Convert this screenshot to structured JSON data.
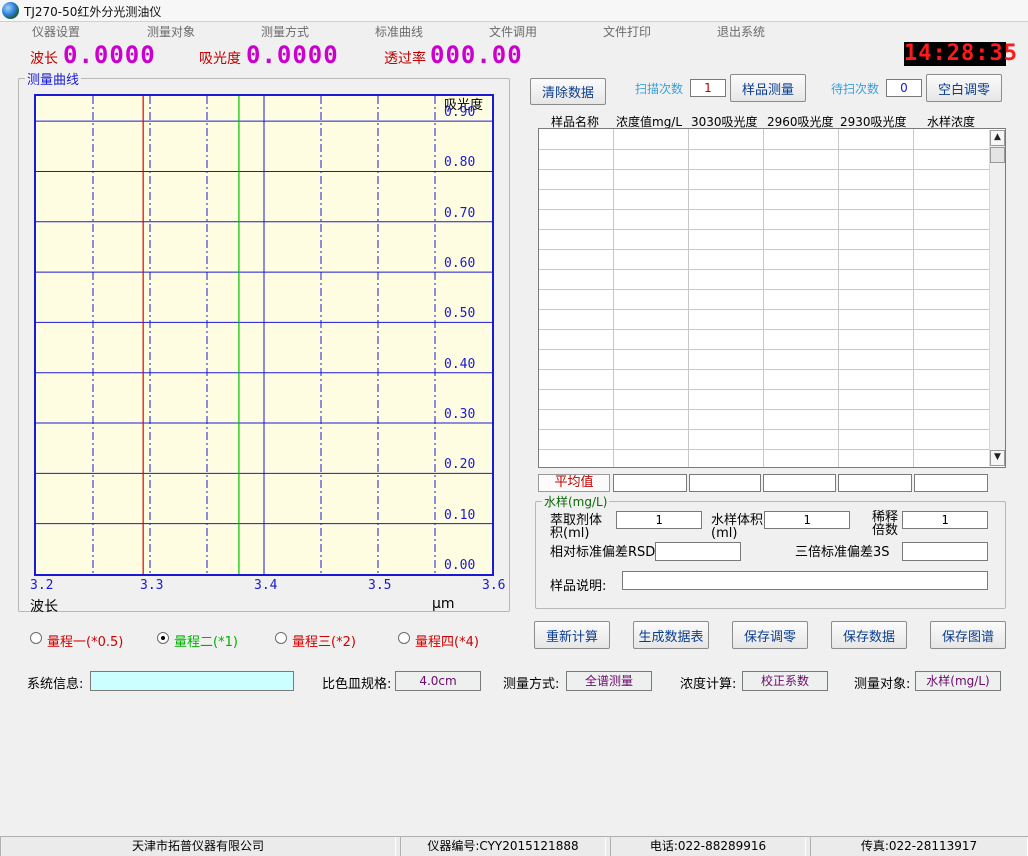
{
  "window": {
    "title": "TJ270-50红外分光测油仪"
  },
  "menu": [
    "仪器设置",
    "测量对象",
    "测量方式",
    "标准曲线",
    "文件调用",
    "文件打印",
    "退出系统"
  ],
  "readouts": {
    "wavelength_label": "波长",
    "wavelength_value": "0.0000",
    "absorbance_label": "吸光度",
    "absorbance_value": "0.0000",
    "transmittance_label": "透过率",
    "transmittance_value": "000.00"
  },
  "clock": "14:28:35",
  "colors": {
    "plot_bg": "#fffde1",
    "plot_axis": "#1a1ad6",
    "red_marker": "#e00000",
    "green_marker": "#00c000"
  },
  "chart_data": {
    "type": "line",
    "title": "测量曲线",
    "xlabel": "波长",
    "xunit": "μm",
    "ylabel": "吸光度",
    "xlim": [
      3.2,
      3.6
    ],
    "ylim": [
      0.0,
      0.95
    ],
    "x_ticks": [
      "3.2",
      "3.3",
      "3.4",
      "3.5",
      "3.6"
    ],
    "y_ticks": [
      "0.90",
      "0.80",
      "0.70",
      "0.60",
      "0.50",
      "0.40",
      "0.30",
      "0.20",
      "0.10",
      "0.00"
    ],
    "markers": [
      {
        "name": "red",
        "x": 3.294,
        "color": "#e00000"
      },
      {
        "name": "green",
        "x": 3.378,
        "color": "#00c000"
      }
    ],
    "series": []
  },
  "range": {
    "options": [
      {
        "label": "量程一(*0.5)",
        "color": "#d00000",
        "checked": false
      },
      {
        "label": "量程二(*1)",
        "color": "#00b000",
        "checked": true
      },
      {
        "label": "量程三(*2)",
        "color": "#d00000",
        "checked": false
      },
      {
        "label": "量程四(*4)",
        "color": "#d00000",
        "checked": false
      }
    ]
  },
  "toolbar": {
    "clear_label": "清除数据",
    "scan_count_label": "扫描次数",
    "scan_count_value": "1",
    "sample_measure_label": "样品测量",
    "pending_scan_label": "待扫次数",
    "pending_scan_value": "0",
    "blank_zero_label": "空白调零"
  },
  "table": {
    "headers": [
      "样品名称",
      "浓度值mg/L",
      "3030吸光度",
      "2960吸光度",
      "2930吸光度",
      "水样浓度"
    ],
    "rows": [],
    "average_label": "平均值"
  },
  "water_sample": {
    "caption": "水样(mg/L)",
    "extractant_volume_label": "萃取剂体积(ml)",
    "extractant_volume_value": "1",
    "sample_volume_label": "水样体积(ml)",
    "sample_volume_value": "1",
    "dilution_label": "稀释倍数",
    "dilution_value": "1",
    "rsd_label": "相对标准偏差RSD",
    "rsd_value": "",
    "three_sd_label": "三倍标准偏差3S",
    "three_sd_value": "",
    "description_label": "样品说明:",
    "description_value": ""
  },
  "actions": [
    "重新计算",
    "生成数据表",
    "保存调零",
    "保存数据",
    "保存图谱"
  ],
  "info": {
    "system_label": "系统信息:",
    "system_value": "",
    "cuvette_label": "比色皿规格:",
    "cuvette_value": "4.0cm",
    "mode_label": "测量方式:",
    "mode_value": "全谱测量",
    "calc_label": "浓度计算:",
    "calc_value": "校正系数",
    "object_label": "测量对象:",
    "object_value": "水样(mg/L)"
  },
  "status": {
    "company": "天津市拓普仪器有限公司",
    "instrument_no": "仪器编号:CYY2015121888",
    "phone": "电话:022-88289916",
    "fax": "传真:022-28113917"
  }
}
